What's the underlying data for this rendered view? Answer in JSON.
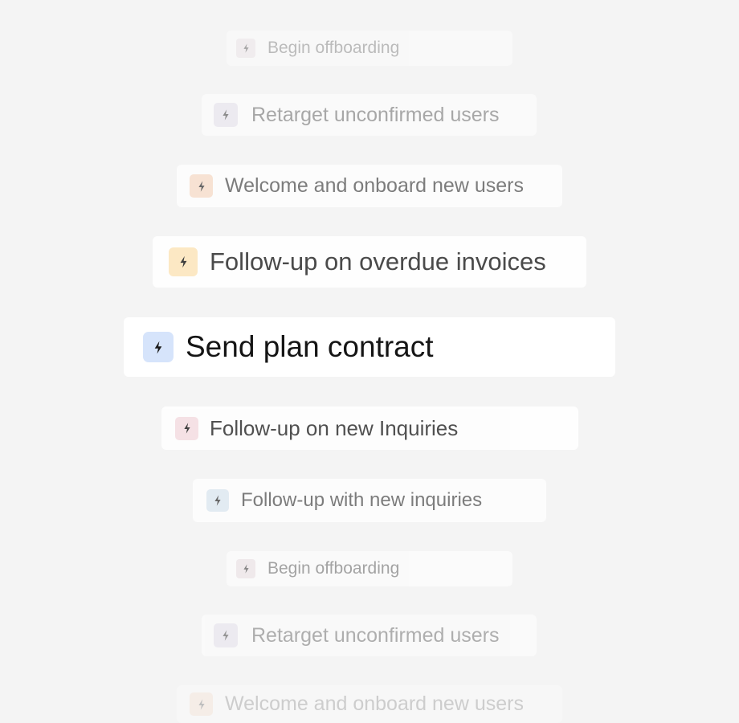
{
  "automations": [
    {
      "label": "Begin offboarding",
      "icon": "lightning-bolt-icon",
      "icon_bg": "#ece2e6"
    },
    {
      "label": "Retarget unconfirmed users",
      "icon": "lightning-bolt-icon",
      "icon_bg": "#e6e2ee"
    },
    {
      "label": "Welcome and onboard new users",
      "icon": "lightning-bolt-icon",
      "icon_bg": "#f8dcc8"
    },
    {
      "label": "Follow-up on overdue invoices",
      "icon": "lightning-bolt-icon",
      "icon_bg": "#fde8c0"
    },
    {
      "label": "Send plan contract",
      "icon": "lightning-bolt-icon",
      "icon_bg": "#d6e4fb",
      "selected": true
    },
    {
      "label": "Follow-up on new Inquiries",
      "icon": "lightning-bolt-icon",
      "icon_bg": "#f6e0e4"
    },
    {
      "label": "Follow-up with new inquiries",
      "icon": "lightning-bolt-icon",
      "icon_bg": "#dde8f2"
    },
    {
      "label": "Begin offboarding",
      "icon": "lightning-bolt-icon",
      "icon_bg": "#ece2e6"
    },
    {
      "label": "Retarget unconfirmed users",
      "icon": "lightning-bolt-icon",
      "icon_bg": "#e6e2ee"
    },
    {
      "label": "Welcome and onboard new users",
      "icon": "lightning-bolt-icon",
      "icon_bg": "#f8dcc8"
    }
  ]
}
